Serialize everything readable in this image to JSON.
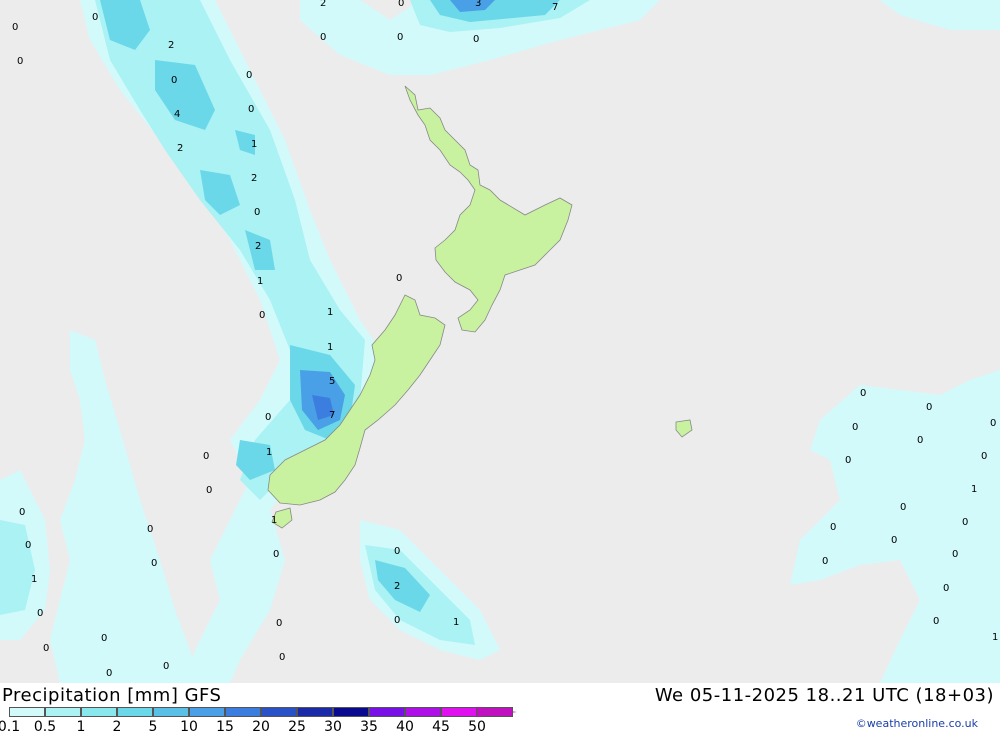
{
  "map": {
    "title": "Precipitation [mm] GFS",
    "datetime": "We 05-11-2025 18..21 UTC (18+03)",
    "credit": "©weatheronline.co.uk",
    "legend": {
      "ticks": [
        "0.1",
        "0.5",
        "1",
        "2",
        "5",
        "10",
        "15",
        "20",
        "25",
        "30",
        "35",
        "40",
        "45",
        "50"
      ],
      "colors": [
        "#d2fafb",
        "#aaf2f4",
        "#88e8ee",
        "#6ad8e8",
        "#5ac0e8",
        "#4aa0e6",
        "#3c7ee0",
        "#2a52c8",
        "#1a2aa8",
        "#0a0a90",
        "#7a10e8",
        "#b010e8",
        "#e010f0",
        "#c010c0"
      ]
    },
    "colors": {
      "sea": "#ececec",
      "land": "#c8f2a0",
      "light": "#d2fafb",
      "mid": "#aaf2f4",
      "strong": "#6ad8e8",
      "heavy": "#4aa0e6",
      "max": "#3c7ee0"
    },
    "values": [
      "0",
      "0",
      "0",
      "0",
      "2",
      "0",
      "3",
      "7",
      "0",
      "0",
      "2",
      "0",
      "0",
      "4",
      "0",
      "2",
      "1",
      "2",
      "0",
      "2",
      "1",
      "0",
      "1",
      "1",
      "0",
      "5",
      "7",
      "0",
      "0",
      "1",
      "0",
      "0",
      "1",
      "0",
      "0",
      "0",
      "0",
      "1",
      "0",
      "0",
      "0",
      "0",
      "0",
      "0",
      "2",
      "0",
      "1",
      "0",
      "0",
      "0",
      "0",
      "0",
      "0",
      "0",
      "0",
      "0",
      "0",
      "1",
      "0",
      "0",
      "0",
      "0",
      "0",
      "0",
      "1",
      "0"
    ]
  }
}
